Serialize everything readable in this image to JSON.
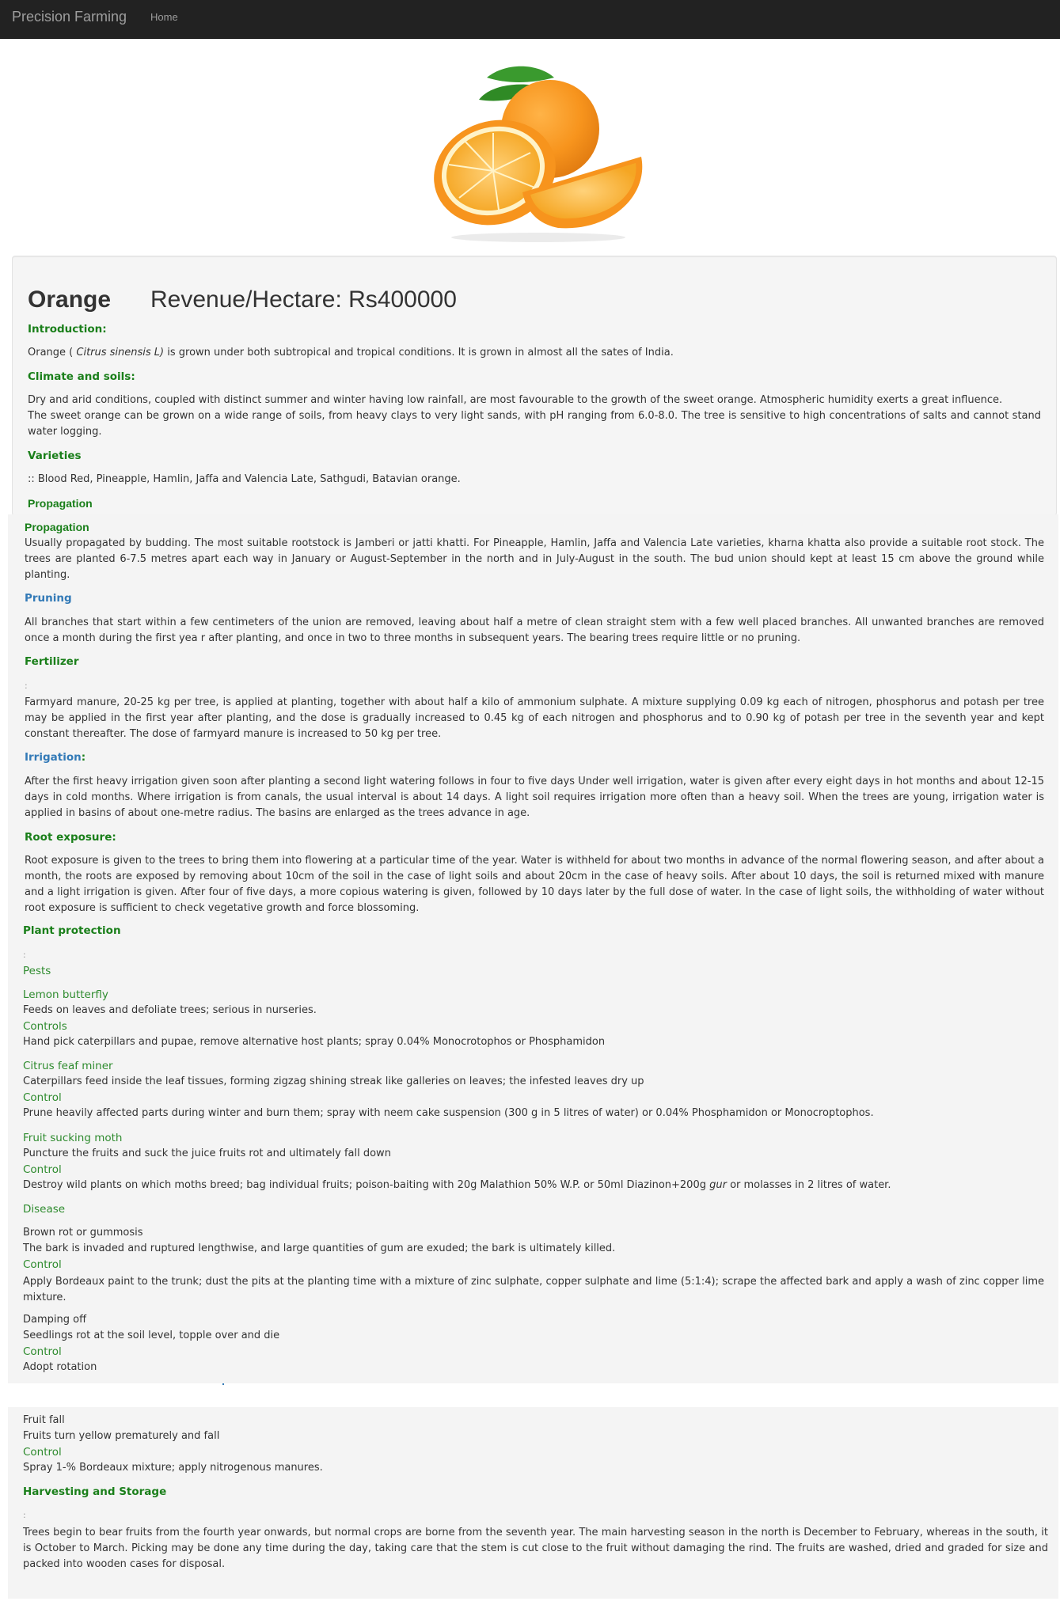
{
  "navbar": {
    "brand": "Precision Farming",
    "home": "Home"
  },
  "header": {
    "title": "Orange",
    "revenue": "Revenue/Hectare: Rs400000"
  },
  "intro": {
    "heading": "Introduction:",
    "pre": "Orange ( ",
    "italic": "Citrus sinensis L)",
    "post": " is grown under both subtropical and tropical conditions. It is grown in almost all the sates of India."
  },
  "climate": {
    "heading": "Climate and soils:",
    "line1": "Dry and arid conditions, coupled with distinct summer and winter having low rainfall, are most favourable to the growth of the sweet orange. Atmospheric humidity exerts a great influence.",
    "line2": "The sweet orange can be grown on a wide range of soils, from heavy clays to very light sands, with pH ranging from 6.0-8.0. The tree is sensitive to high concentrations of salts and cannot stand water logging."
  },
  "varieties": {
    "heading": "Varieties",
    "text": ":: Blood Red, Pineapple, Hamlin, Jaffa and Valencia Late, Sathgudi, Batavian orange."
  },
  "propagation": {
    "heading1": "Propagation",
    "heading2": "Propagation",
    "text": "Usually propagated by budding. The most suitable rootstock is Jamberi or jatti khatti. For Pineapple, Hamlin, Jaffa and Valencia Late varieties, kharna khatta also provide a suitable root stock. The trees are planted 6-7.5 metres apart each way in January or August-September in the north and in July-August in the south. The bud union should kept at least 15 cm above the ground while planting."
  },
  "pruning": {
    "heading": "Pruning",
    "text": "All branches that start within a few centimeters of the union are removed, leaving about half a metre of clean straight stem with a few well placed branches. All unwanted branches are removed once a month during the first yea r after planting, and once in two to three months in subsequent years. The bearing trees require little or no pruning."
  },
  "fertilizer": {
    "heading": "Fertilizer",
    "mark": ":",
    "text": "Farmyard manure, 20-25 kg per tree, is applied at planting, together with about half a kilo of ammonium sulphate. A mixture supplying 0.09 kg each of nitrogen, phosphorus and potash per tree may be applied in the first year after planting, and the dose is gradually increased to 0.45 kg of each nitrogen and phosphorus and to 0.90 kg of potash per tree in the seventh year and kept constant thereafter. The dose of farmyard manure is increased to 50 kg per tree."
  },
  "irrigation": {
    "heading": "Irrigation",
    "colon": ":",
    "text": "After the first heavy irrigation given soon after planting a second light watering follows in four to five days Under well irrigation, water is given after every eight days in hot months and about 12-15 days in cold months. Where irrigation is from canals, the usual interval is about 14 days. A light soil requires irrigation more often than a heavy soil. When the trees are young, irrigation water is applied in basins of about one-metre radius. The basins are enlarged as the trees advance in age."
  },
  "root": {
    "heading": "Root exposure:",
    "text": "Root exposure is given to the trees to bring them into flowering at a particular time of the year. Water is withheld for about two months in advance of the normal flowering season, and after about a month, the roots are exposed by removing about 10cm of the soil in the case of light soils and about 20cm in the case of heavy soils. After about 10 days, the soil is returned mixed with manure and a light irrigation is given. After four of five days, a more copious watering is given, followed by 10 days later by the full dose of water. In the case of light soils, the withholding of water without root exposure is sufficient to check vegetative growth and force blossoming."
  },
  "protection": {
    "heading": "Plant protection",
    "mark": ":",
    "pests": "Pests",
    "lemon": {
      "name": "Lemon butterfly",
      "desc": "Feeds on leaves and defoliate trees; serious in nurseries.",
      "ctl": "Controls",
      "ctl_text": "Hand pick caterpillars and pupae, remove alternative host plants; spray 0.04% Monocrotophos or Phosphamidon"
    },
    "miner": {
      "name": "Citrus feaf miner",
      "desc": "Caterpillars feed inside the leaf tissues, forming zigzag shining streak like galleries on leaves; the infested leaves dry up",
      "ctl": "Control",
      "ctl_text": "Prune heavily affected parts during winter and burn them; spray with neem cake suspension (300 g in 5 litres of water) or 0.04% Phosphamidon or Monocroptophos."
    },
    "moth": {
      "name": "Fruit sucking moth",
      "desc": "Puncture the fruits and suck the juice fruits rot and ultimately fall down",
      "ctl": "Control",
      "ctl_pre": "Destroy wild plants on which moths breed; bag individual fruits; poison-baiting with 20g Malathion 50% W.P. or 50ml Diazinon+200g ",
      "ctl_it": "gur",
      "ctl_post": " or molasses in 2 litres of water."
    },
    "disease": "Disease",
    "brown": {
      "name": "Brown rot or gummosis",
      "desc": "The bark is invaded and ruptured lengthwise, and large quantities of gum are exuded; the bark is ultimately killed.",
      "ctl": "Control",
      "ctl_text": "Apply Bordeaux paint to the trunk; dust the pits at the planting time with a mixture of zinc sulphate, copper sulphate and lime (5:1:4); scrape the affected bark and apply a wash of zinc copper lime mixture."
    },
    "damping": {
      "name": "Damping off",
      "desc": "Seedlings rot at the soil level, topple over and die",
      "ctl": "Control",
      "ctl_text": "Adopt rotation"
    },
    "fall": {
      "name": "Fruit fall",
      "desc": "Fruits turn yellow prematurely and fall",
      "ctl": "Control",
      "ctl_text": "Spray 1-% Bordeaux mixture; apply nitrogenous manures."
    }
  },
  "harvest": {
    "heading": "Harvesting and Storage",
    "mark": ":",
    "text": "Trees begin to bear fruits from the fourth year onwards, but normal crops are borne from the seventh year. The main harvesting season in the north is December to February, whereas in the south, it is October to March. Picking may be done any time during the day, taking care that the stem is cut close to the fruit without damaging the rind. The fruits are washed, dried and graded for size and packed into wooden cases for disposal."
  }
}
